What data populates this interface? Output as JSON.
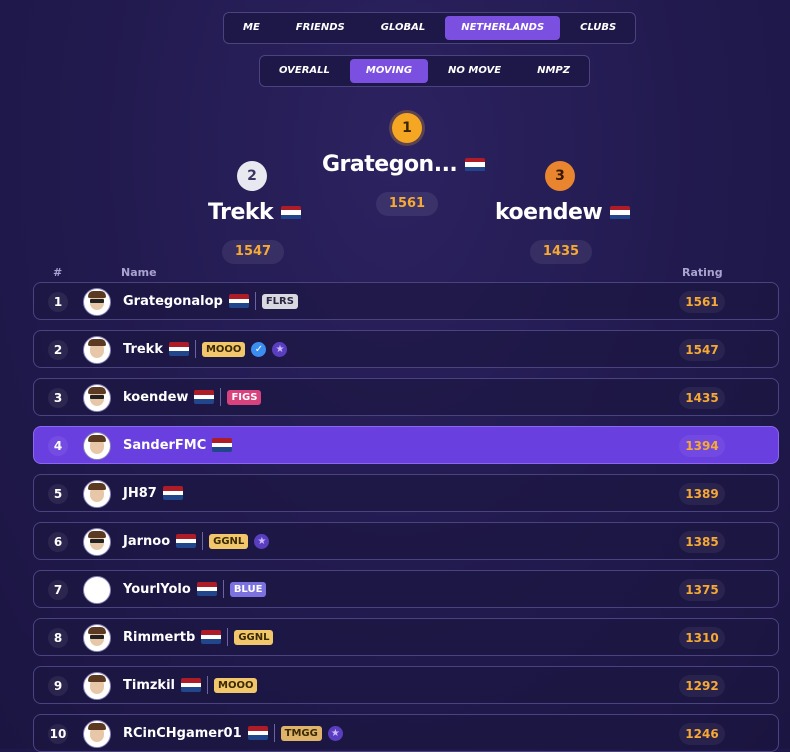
{
  "scope_tabs": [
    {
      "label": "ME",
      "active": false
    },
    {
      "label": "FRIENDS",
      "active": false
    },
    {
      "label": "GLOBAL",
      "active": false
    },
    {
      "label": "NETHERLANDS",
      "active": true
    },
    {
      "label": "CLUBS",
      "active": false
    }
  ],
  "mode_tabs": [
    {
      "label": "OVERALL",
      "active": false
    },
    {
      "label": "MOVING",
      "active": true
    },
    {
      "label": "NO MOVE",
      "active": false
    },
    {
      "label": "NMPZ",
      "active": false
    }
  ],
  "podium": {
    "first": {
      "rank": "1",
      "name": "Grategon...",
      "rating": "1561",
      "color": "#f5a623"
    },
    "second": {
      "rank": "2",
      "name": "Trekk",
      "rating": "1547",
      "color": "#e8e8f0"
    },
    "third": {
      "rank": "3",
      "name": "koendew",
      "rating": "1435",
      "color": "#e8852e"
    }
  },
  "columns": {
    "rank": "#",
    "name": "Name",
    "rating": "Rating"
  },
  "rows": [
    {
      "rank": "1",
      "name": "Grategonalop",
      "tag": "FLRS",
      "rating": "1561",
      "highlight": false
    },
    {
      "rank": "2",
      "name": "Trekk",
      "tag": "MOOO",
      "rating": "1547",
      "highlight": false
    },
    {
      "rank": "3",
      "name": "koendew",
      "tag": "FIGS",
      "rating": "1435",
      "highlight": false
    },
    {
      "rank": "4",
      "name": "SanderFMC",
      "tag": "",
      "rating": "1394",
      "highlight": true
    },
    {
      "rank": "5",
      "name": "JH87",
      "tag": "",
      "rating": "1389",
      "highlight": false
    },
    {
      "rank": "6",
      "name": "Jarnoo",
      "tag": "GGNL",
      "rating": "1385",
      "highlight": false
    },
    {
      "rank": "7",
      "name": "YourlYolo",
      "tag": "BLUE",
      "rating": "1375",
      "highlight": false
    },
    {
      "rank": "8",
      "name": "Rimmertb",
      "tag": "GGNL",
      "rating": "1310",
      "highlight": false
    },
    {
      "rank": "9",
      "name": "Timzkil",
      "tag": "MOOO",
      "rating": "1292",
      "highlight": false
    },
    {
      "rank": "10",
      "name": "RCinCHgamer01",
      "tag": "TMGG",
      "rating": "1246",
      "highlight": false
    }
  ],
  "colors": {
    "accent": "#7b4fe0",
    "rating": "#f6a935",
    "tag_FLRS": "#d8d8e0",
    "tag_MOOO": "#f2c66b",
    "tag_FIGS": "#d8437e",
    "tag_GGNL": "#f2c66b",
    "tag_BLUE": "#7b72e0",
    "tag_TMGG": "#e0b36a"
  },
  "icons": {
    "flag": "netherlands-flag-icon",
    "verified": "verified-check-icon",
    "pro": "pro-badge-icon"
  }
}
